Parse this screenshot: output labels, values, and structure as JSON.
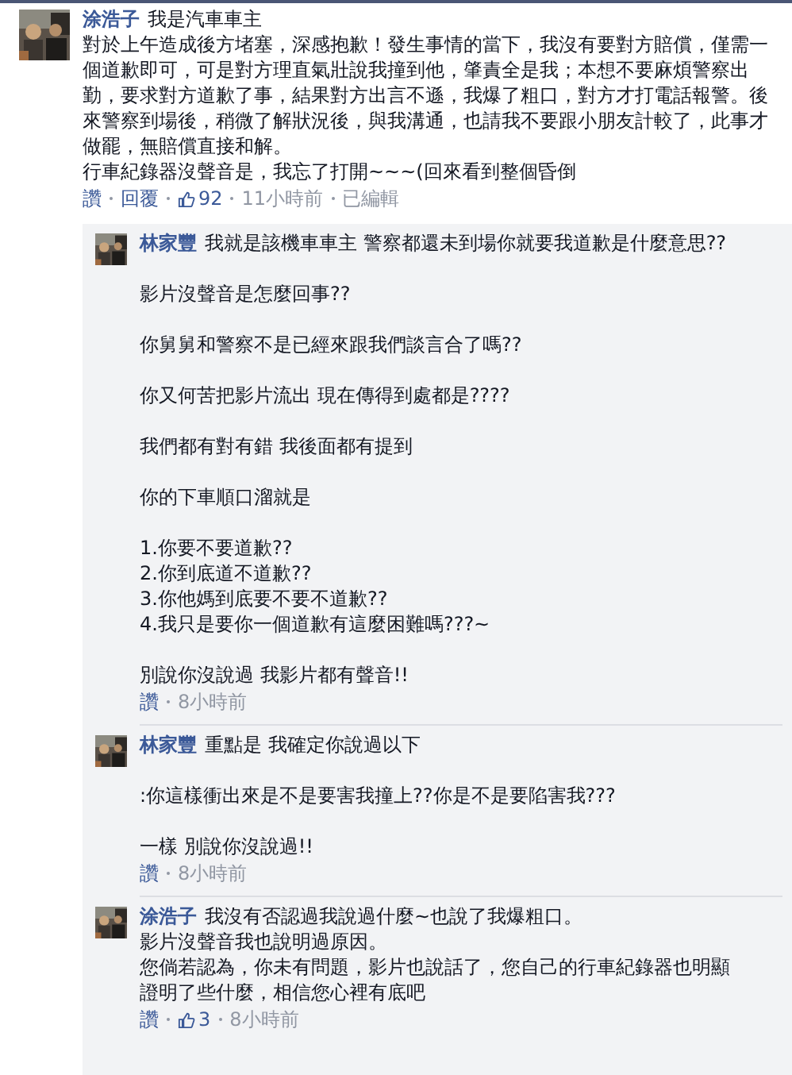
{
  "comment": {
    "author": "涂浩子",
    "paragraphs": [
      [
        "我是汽車車主",
        "對於上午造成後方堵塞，深感抱歉！發生事情的當下，我沒有要對方賠償，僅需一個道歉即可，可是對方理直氣壯說我撞到他，肇責全是我；本想不要麻煩警察出勤，要求對方道歉了事，結果對方出言不遜，我爆了粗口，對方才打電話報警。後來警察到場後，稍微了解狀況後，與我溝通，也請我不要跟小朋友計較了，此事才做罷，無賠償直接和解。",
        "行車紀錄器沒聲音是，我忘了打開~~~(回來看到整個昏倒"
      ]
    ],
    "actions": [
      {
        "kind": "link",
        "label": "讚"
      },
      {
        "kind": "link",
        "label": "回覆"
      },
      {
        "kind": "likes",
        "label": "92"
      },
      {
        "kind": "time",
        "label": "11小時前"
      },
      {
        "kind": "note",
        "label": "已編輯"
      }
    ],
    "replies": [
      {
        "author": "林家豐",
        "paragraphs": [
          [
            "我就是該機車車主 警察都還未到場你就要我道歉是什麼意思??"
          ],
          [
            "影片沒聲音是怎麼回事??"
          ],
          [
            "你舅舅和警察不是已經來跟我們談言合了嗎??"
          ],
          [
            "你又何苦把影片流出 現在傳得到處都是????"
          ],
          [
            "我們都有對有錯 我後面都有提到"
          ],
          [
            "你的下車順口溜就是"
          ],
          [
            "1.你要不要道歉??",
            "2.你到底道不道歉??",
            "3.你他媽到底要不要不道歉??",
            "4.我只是要你一個道歉有這麼困難嗎???~"
          ],
          [
            "別說你沒說過 我影片都有聲音!!"
          ]
        ],
        "actions": [
          {
            "kind": "link",
            "label": "讚"
          },
          {
            "kind": "time",
            "label": "8小時前"
          }
        ]
      },
      {
        "author": "林家豐",
        "paragraphs": [
          [
            "重點是 我確定你說過以下"
          ],
          [
            ":你這樣衝出來是不是要害我撞上??你是不是要陷害我???"
          ],
          [
            "一樣 別說你沒說過!!"
          ]
        ],
        "actions": [
          {
            "kind": "link",
            "label": "讚"
          },
          {
            "kind": "time",
            "label": "8小時前"
          }
        ]
      },
      {
        "author": "涂浩子",
        "paragraphs": [
          [
            "我沒有否認過我說過什麼~也說了我爆粗口。",
            "影片沒聲音我也說明過原因。",
            "您倘若認為，你未有問題，影片也說話了，您自己的行車紀錄器也明顯證明了些什麼，相信您心裡有底吧"
          ]
        ],
        "actions": [
          {
            "kind": "link",
            "label": "讚"
          },
          {
            "kind": "likes",
            "label": "3"
          },
          {
            "kind": "time",
            "label": "8小時前"
          }
        ]
      }
    ]
  }
}
